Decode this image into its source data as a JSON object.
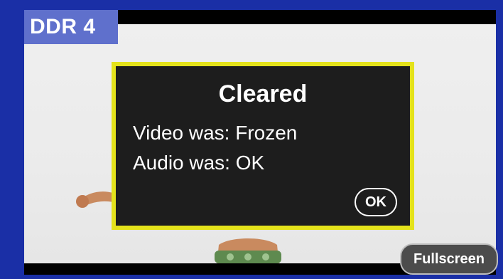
{
  "tag": {
    "label": "DDR 4"
  },
  "dialog": {
    "title": "Cleared",
    "video_status": "Video was: Frozen",
    "audio_status": "Audio was: OK",
    "ok_label": "OK"
  },
  "controls": {
    "fullscreen_label": "Fullscreen"
  },
  "colors": {
    "frame": "#1a2fa6",
    "tag_bg": "#5f70cc",
    "dialog_border": "#e4e21b",
    "dialog_bg": "#1d1d1d"
  }
}
